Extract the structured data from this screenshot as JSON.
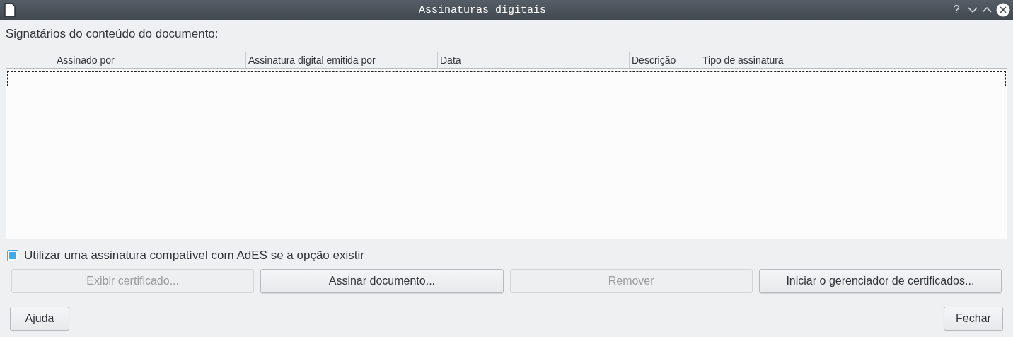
{
  "window": {
    "title": "Assinaturas digitais",
    "controls": [
      {
        "kind": "help",
        "label": "?"
      },
      {
        "kind": "minimize"
      },
      {
        "kind": "maximize"
      },
      {
        "kind": "close"
      }
    ]
  },
  "signers_label": "Signatários do conteúdo do documento:",
  "table": {
    "columns": [
      "",
      "Assinado por",
      "Assinatura digital emitida por",
      "Data",
      "Descrição",
      "Tipo de assinatura"
    ],
    "focused_empty_row": true
  },
  "ades_option": {
    "label": "Utilizar uma assinatura compatível com AdES se a opção existir",
    "checked": true
  },
  "actions": [
    {
      "label": "Exibir certificado...",
      "disabled": true
    },
    {
      "label": "Assinar documento...",
      "disabled": false
    },
    {
      "label": "Remover",
      "disabled": true
    },
    {
      "label": "Iniciar o gerenciador de certificados...",
      "disabled": false
    }
  ],
  "footer": [
    {
      "kind": "help",
      "label": "Ajuda"
    },
    {
      "kind": "close",
      "label": "Fechar"
    }
  ]
}
